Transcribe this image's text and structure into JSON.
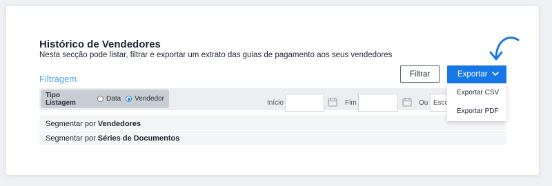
{
  "page": {
    "title": "Histórico de Vendedores",
    "subtitle": "Nesta secção pode listar, filtrar e exportar um extrato das guias de pagamento aos seus vendedores"
  },
  "filters": {
    "heading": "Filtragem",
    "list_type_label": "Tipo Listagem",
    "radio_options": [
      {
        "label": "Data",
        "selected": false
      },
      {
        "label": "Vendedor",
        "selected": true
      }
    ],
    "start_label": "Início",
    "end_label": "Fim",
    "or_label": "Ou",
    "select_placeholder": "Esco"
  },
  "actions": {
    "filter_button": "Filtrar",
    "export_button": "Exportar",
    "export_menu": [
      "Exportar CSV",
      "Exportar PDF"
    ]
  },
  "segments": [
    {
      "prefix": "Segmentar por",
      "target": "Vendedores"
    },
    {
      "prefix": "Segmentar por",
      "target": "Séries de Documentos"
    }
  ],
  "colors": {
    "accent": "#1777e6",
    "heading_link": "#4fa6e8",
    "bar_bg": "#eceef1",
    "chip_bg": "#c9ced5"
  },
  "icons": [
    "calendar-icon",
    "chevron-down-icon",
    "curved-arrow-icon"
  ]
}
